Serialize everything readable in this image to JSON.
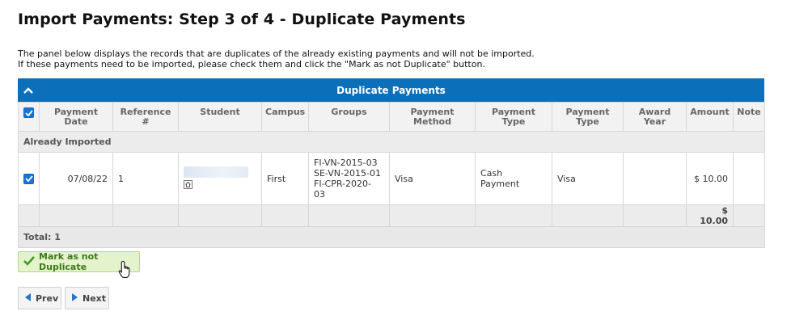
{
  "page": {
    "title": "Import Payments: Step 3 of 4 - Duplicate Payments",
    "intro_line1": "The panel below displays the records that are duplicates of the already existing payments and will not be imported.",
    "intro_line2": "If these payments need to be imported, please check them and click the \"Mark as not Duplicate\" button."
  },
  "panel": {
    "title": "Duplicate Payments",
    "columns": {
      "payment_date_1": "Payment",
      "payment_date_2": "Date",
      "reference_1": "Reference",
      "reference_2": "#",
      "student": "Student",
      "campus": "Campus",
      "groups": "Groups",
      "payment_method_1": "Payment",
      "payment_method_2": "Method",
      "payment_type_1": "Payment",
      "payment_type_2": "Type",
      "payment_type2_1": "Payment",
      "payment_type2_2": "Type",
      "award_year_1": "Award",
      "award_year_2": "Year",
      "amount": "Amount",
      "note": "Note"
    },
    "group_label": "Already Imported",
    "row": {
      "payment_date": "07/08/22",
      "reference": "1",
      "campus": "First",
      "groups_1": "FI-VN-2015-03",
      "groups_2": "SE-VN-2015-01",
      "groups_3": "FI-CPR-2020-",
      "groups_4": "03",
      "payment_method": "Visa",
      "payment_type_1": "Cash",
      "payment_type_2": "Payment",
      "payment_type2": "Visa",
      "award_year": "",
      "amount": "$ 10.00",
      "note": ""
    },
    "sum_amount": "$ 10.00",
    "total": "Total: 1"
  },
  "buttons": {
    "mark_not_duplicate": "Mark as not Duplicate",
    "prev": "Prev",
    "next": "Next"
  },
  "icons": {
    "collapse": "chevron-up-icon",
    "checkbox": "checkbox-checked-icon",
    "student_home": "home-icon",
    "mark": "checkmark-icon",
    "prev": "triangle-left-icon",
    "next": "triangle-right-icon"
  },
  "colors": {
    "header_blue": "#0b6fba",
    "checkbox_blue": "#1a73d6",
    "link_blue": "#1f6fb2",
    "mark_button_bg": "#e4f3cc",
    "mark_button_text": "#3d7a16"
  }
}
